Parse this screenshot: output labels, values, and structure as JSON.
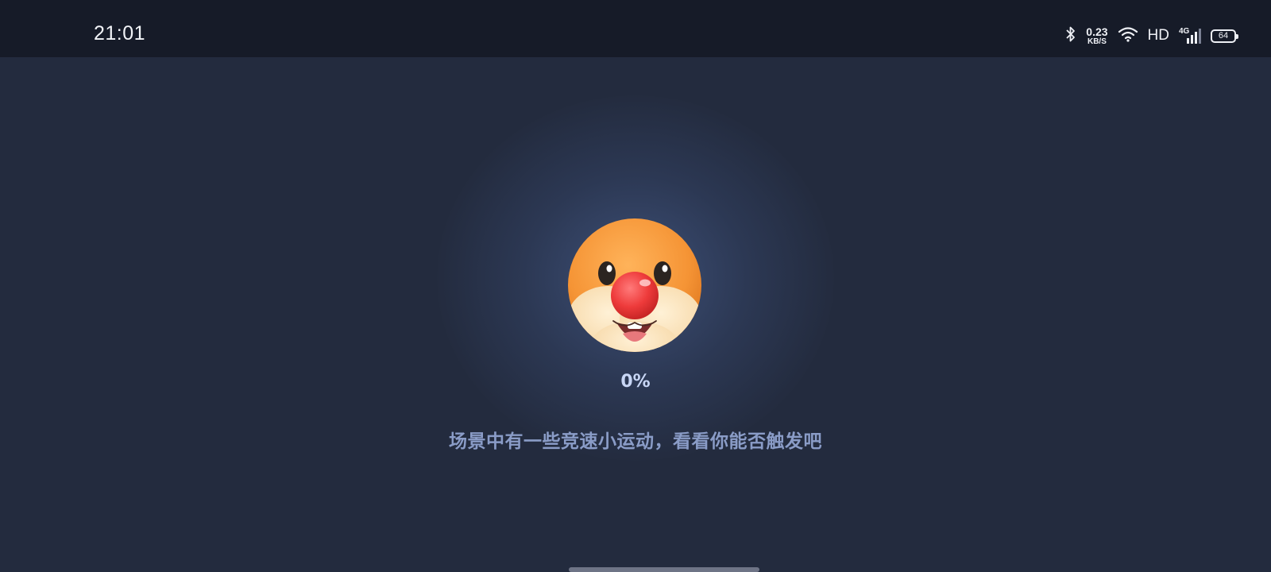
{
  "status_bar": {
    "time": "21:01",
    "net_speed_value": "0.23",
    "net_speed_unit": "KB/S",
    "hd_label": "HD",
    "network_type": "4G",
    "battery_level": "64",
    "icons": [
      "bluetooth-icon",
      "wifi-icon",
      "cellular-signal-icon",
      "battery-icon"
    ]
  },
  "loading": {
    "progress": "0%",
    "tip": "场景中有一些竞速小运动，看看你能否触发吧"
  },
  "colors": {
    "background": "#232b3e",
    "status_bar_bg": "#161b28",
    "mascot_orange": "#f5993c",
    "mascot_nose": "#ee3b3b",
    "progress_text": "#c8d6f5",
    "tip_text": "#8a9cc7"
  }
}
